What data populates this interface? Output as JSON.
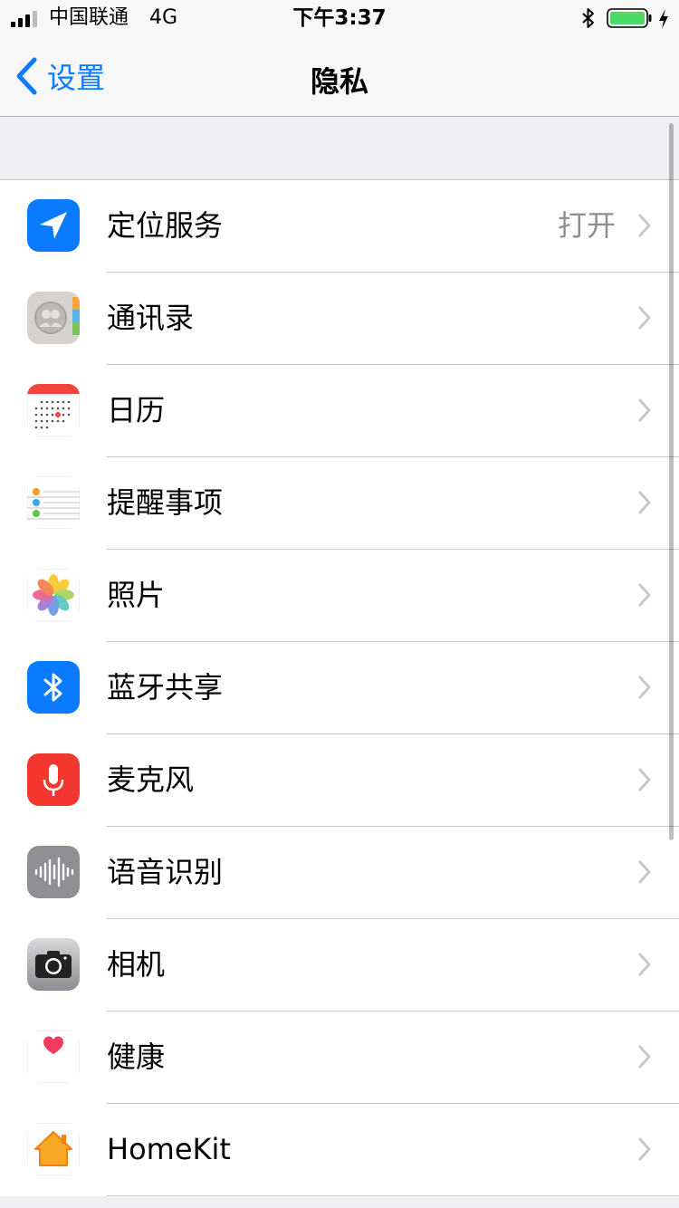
{
  "status_bar": {
    "carrier": "中国联通",
    "network": "4G",
    "time": "下午3:37",
    "battery_color": "#4cd964"
  },
  "nav": {
    "back_label": "设置",
    "title": "隐私"
  },
  "colors": {
    "accent": "#0a7aff",
    "chevron": "#c7c7cc",
    "secondary_text": "#8e8e93"
  },
  "items": [
    {
      "label": "定位服务",
      "value": "打开",
      "icon": "location-arrow-icon"
    },
    {
      "label": "通讯录",
      "value": "",
      "icon": "contacts-icon"
    },
    {
      "label": "日历",
      "value": "",
      "icon": "calendar-icon"
    },
    {
      "label": "提醒事项",
      "value": "",
      "icon": "reminders-icon"
    },
    {
      "label": "照片",
      "value": "",
      "icon": "photos-icon"
    },
    {
      "label": "蓝牙共享",
      "value": "",
      "icon": "bluetooth-icon"
    },
    {
      "label": "麦克风",
      "value": "",
      "icon": "microphone-icon"
    },
    {
      "label": "语音识别",
      "value": "",
      "icon": "speech-recognition-icon"
    },
    {
      "label": "相机",
      "value": "",
      "icon": "camera-icon"
    },
    {
      "label": "健康",
      "value": "",
      "icon": "health-heart-icon"
    },
    {
      "label": "HomeKit",
      "value": "",
      "icon": "homekit-house-icon"
    }
  ]
}
